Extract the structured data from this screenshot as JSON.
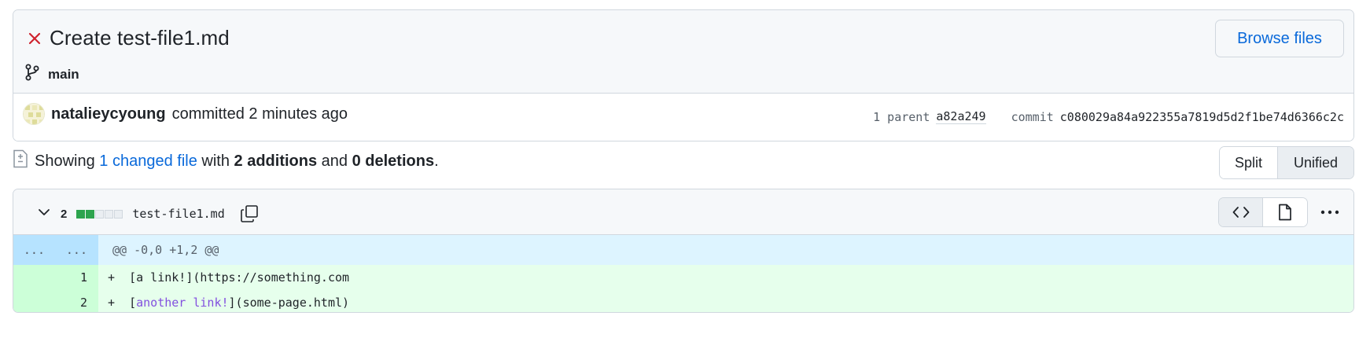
{
  "commit": {
    "title": "Create test-file1.md",
    "status_icon": "x-icon",
    "branch_icon": "git-branch-icon",
    "branch": "main",
    "browse_files_label": "Browse files",
    "author": "natalieycyoung",
    "action_text": "committed 2 minutes ago",
    "parent_label": "1 parent",
    "parent_sha": "a82a249",
    "commit_label": "commit",
    "commit_sha": "c080029a84a922355a7819d5d2f1be74d6366c2c"
  },
  "summary": {
    "prefix": "Showing",
    "changed_files": "1 changed file",
    "with": "with",
    "additions": "2 additions",
    "and": "and",
    "deletions": "0 deletions",
    "suffix": ".",
    "view_split": "Split",
    "view_unified": "Unified",
    "selected_view": "Unified"
  },
  "file": {
    "change_count": "2",
    "diffstat": {
      "additions_boxes": 2,
      "total_boxes": 5
    },
    "name": "test-file1.md",
    "icons": [
      "chevron-down-icon",
      "copy-icon",
      "code-icon",
      "file-icon",
      "kebab-icon"
    ]
  },
  "diff": {
    "hunk": {
      "left": "...",
      "right": "...",
      "header": "@@ -0,0 +1,2 @@"
    },
    "lines": [
      {
        "type": "add",
        "left": "",
        "right": "1",
        "marker": "+",
        "pre": "[",
        "link": "a link!",
        "post": "](https://something.com",
        "link_colored": false
      },
      {
        "type": "add",
        "left": "",
        "right": "2",
        "marker": "+",
        "pre": "[",
        "link": "another link!",
        "post": "](some-page.html)",
        "link_colored": true
      }
    ]
  },
  "colors": {
    "accent": "#0969da",
    "danger": "#cf222e",
    "addition": "#2da44e",
    "hunk_bg": "#ddf4ff",
    "add_bg": "#e6ffec"
  }
}
